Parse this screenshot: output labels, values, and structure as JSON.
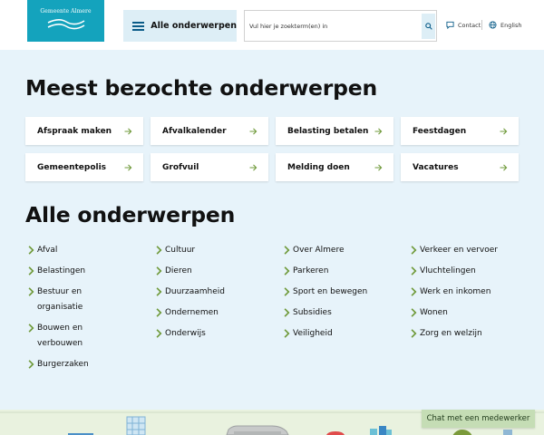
{
  "header": {
    "logo_text": "Gemeente Almere",
    "menu_label": "Alle onderwerpen",
    "search_placeholder": "Vul hier je zoekterm(en) in",
    "contact_label": "Contact",
    "language_label": "English"
  },
  "popular": {
    "title": "Meest bezochte onderwerpen",
    "tiles": [
      {
        "label": "Afspraak maken"
      },
      {
        "label": "Afvalkalender"
      },
      {
        "label": "Belasting betalen"
      },
      {
        "label": "Feestdagen"
      },
      {
        "label": "Gemeentepolis"
      },
      {
        "label": "Grofvuil"
      },
      {
        "label": "Melding doen"
      },
      {
        "label": "Vacatures"
      }
    ]
  },
  "all_subjects": {
    "title": "Alle onderwerpen",
    "columns": [
      [
        "Afval",
        "Belastingen",
        "Bestuur en organisatie",
        "Bouwen en verbouwen",
        "Burgerzaken"
      ],
      [
        "Cultuur",
        "Dieren",
        "Duurzaamheid",
        "Ondernemen",
        "Onderwijs"
      ],
      [
        "Over Almere",
        "Parkeren",
        "Sport en bewegen",
        "Subsidies",
        "Veiligheid"
      ],
      [
        "Verkeer en vervoer",
        "Vluchtelingen",
        "Werk en inkomen",
        "Wonen",
        "Zorg en welzijn"
      ]
    ]
  },
  "chat": {
    "label": "Chat met een medewerker"
  },
  "colors": {
    "logo_bg": "#14a3bd",
    "page_bg": "#e7f3fa",
    "menu_bg": "#ddeef6",
    "chevron_green": "#6f9a3a",
    "chat_bg": "#c5ddb5"
  }
}
